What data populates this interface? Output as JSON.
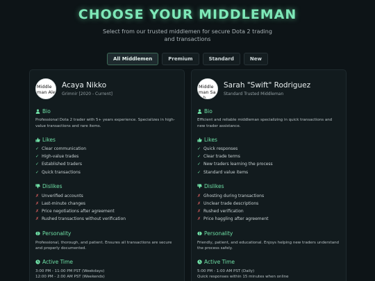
{
  "header": {
    "title": "CHOOSE YOUR MIDDLEMAN",
    "subtitle": "Select from our trusted middlemen for secure Dota 2 trading and transactions"
  },
  "tabs": [
    {
      "label": "All Middlemen",
      "active": true
    },
    {
      "label": "Premium",
      "active": false
    },
    {
      "label": "Standard",
      "active": false
    },
    {
      "label": "New",
      "active": false
    }
  ],
  "colors": {
    "accent": "#6fe0a6",
    "background": "#0d1417",
    "card": "#121b1e",
    "negative": "#e06060"
  },
  "cards": [
    {
      "avatar_alt": "Middleman Alex",
      "name": "Acaya Nikko",
      "role": "Grimnir [2020 - Current]",
      "bio_title": "Bio",
      "bio": "Professional Dota 2 trader with 5+ years experience. Specializes in high-value transactions and rare items.",
      "likes_title": "Likes",
      "likes": [
        "Clear communication",
        "High-value trades",
        "Established traders",
        "Quick transactions"
      ],
      "dislikes_title": "Dislikes",
      "dislikes": [
        "Unverified accounts",
        "Last-minute changes",
        "Price negotiations after agreement",
        "Rushed transactions without verification"
      ],
      "personality_title": "Personality",
      "personality": "Professional, thorough, and patient. Ensures all transactions are secure and properly documented.",
      "active_title": "Active Time",
      "active": [
        "3:00 PM - 11:00 PM PST (Weekdays)",
        "12:00 PM - 2:00 AM PST (Weekends)"
      ]
    },
    {
      "avatar_alt": "Middleman Sarah",
      "name": "Sarah \"Swift\" Rodriguez",
      "role": "Standard Trusted Middleman",
      "bio_title": "Bio",
      "bio": "Efficient and reliable middleman specializing in quick transactions and new trader assistance.",
      "likes_title": "Likes",
      "likes": [
        "Quick responses",
        "Clear trade terms",
        "New traders learning the process",
        "Standard value items"
      ],
      "dislikes_title": "Dislikes",
      "dislikes": [
        "Ghosting during transactions",
        "Unclear trade descriptions",
        "Rushed verification",
        "Price haggling after agreement"
      ],
      "personality_title": "Personality",
      "personality": "Friendly, patient, and educational. Enjoys helping new traders understand the process safely.",
      "active_title": "Active Time",
      "active": [
        "5:00 PM - 1:00 AM PST (Daily)",
        "Quick responses within 15 minutes when online"
      ]
    }
  ]
}
